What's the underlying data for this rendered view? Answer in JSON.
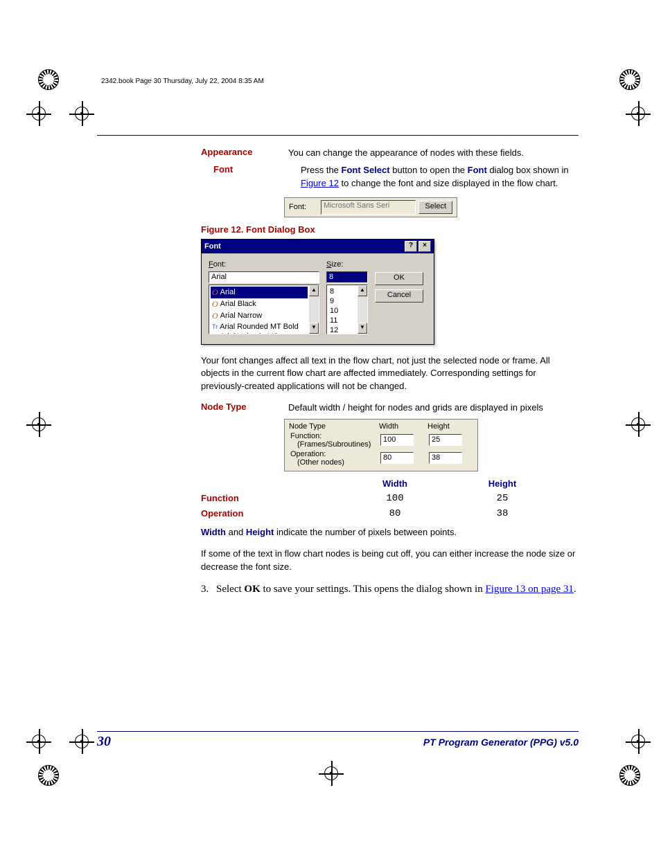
{
  "header_line": "2342.book  Page 30  Thursday, July 22, 2004  8:35 AM",
  "sections": {
    "appearance": {
      "label": "Appearance",
      "text": "You can change the appearance of nodes with these fields."
    },
    "font": {
      "label": "Font",
      "text_prefix": "Press the ",
      "bold1": "Font Select",
      "mid1": " button to open the ",
      "bold2": "Font",
      "mid2": " dialog box shown in ",
      "link": "Figure 12",
      "suffix": " to change the font and size displayed in the flow chart."
    }
  },
  "font_bar": {
    "label": "Font:",
    "value": "Microsoft Sans Seri",
    "button": "Select"
  },
  "figure_caption": "Figure 12. Font Dialog Box",
  "font_dialog": {
    "title": "Font",
    "font_label_prefix": "F",
    "font_label_rest": "ont:",
    "font_value": "Arial",
    "font_list": [
      "Arial",
      "Arial Black",
      "Arial Narrow",
      "Arial Rounded MT Bold",
      "Arial Unicode MS"
    ],
    "size_label_prefix": "S",
    "size_label_rest": "ize:",
    "size_value": "8",
    "size_list": [
      "8",
      "9",
      "10",
      "11",
      "12"
    ],
    "ok": "OK",
    "cancel": "Cancel"
  },
  "font_effect_para": "Your font changes affect all text in the flow chart, not just the selected node or frame. All objects in the current flow chart are affected immediately. Corresponding settings for previously-created applications will not be changed.",
  "nodetype": {
    "label": "Node Type",
    "text": "Default width / height for nodes and grids are displayed in pixels",
    "panel": {
      "head_type": "Node Type",
      "head_width": "Width",
      "head_height": "Height",
      "rows": [
        {
          "label1": "Function:",
          "label2": "(Frames/Subroutines)",
          "width": "100",
          "height": "25"
        },
        {
          "label1": "Operation:",
          "label2": "(Other nodes)",
          "width": "80",
          "height": "38"
        }
      ]
    },
    "table": {
      "col_width": "Width",
      "col_height": "Height",
      "rows": [
        {
          "name": "Function",
          "width": "100",
          "height": "25"
        },
        {
          "name": "Operation",
          "width": "80",
          "height": "38"
        }
      ]
    }
  },
  "width_height_sentence": {
    "w": "Width",
    "and": " and ",
    "h": "Height",
    "rest": " indicate the number of pixels between points."
  },
  "cutoff_para": "If some of the text in flow chart nodes is being cut off, you can either increase the node size or decrease the font size.",
  "step3": {
    "num": "3.",
    "pre": "Select ",
    "ok": "OK",
    "mid": " to save your settings. This opens the dialog shown in ",
    "link": "Figure 13 on page 31",
    "end": "."
  },
  "footer": {
    "page": "30",
    "title": "PT Program Generator (PPG)   v5.0"
  }
}
